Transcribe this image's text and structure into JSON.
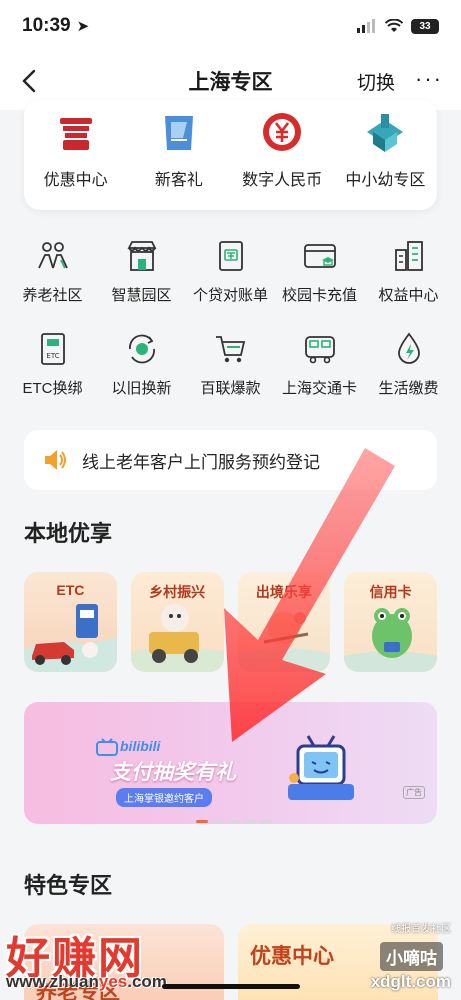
{
  "status": {
    "time": "10:39",
    "battery": "33"
  },
  "nav": {
    "title": "上海专区",
    "switch_label": "切换",
    "more_label": "···"
  },
  "top_items": [
    {
      "label": "优惠中心",
      "icon": "building-icon"
    },
    {
      "label": "新客礼",
      "icon": "gift-icon"
    },
    {
      "label": "数字人民币",
      "icon": "yuan-icon"
    },
    {
      "label": "中小幼专区",
      "icon": "cube-building-icon"
    }
  ],
  "grid_items": [
    {
      "label": "养老社区",
      "icon": "elderly-icon"
    },
    {
      "label": "智慧园区",
      "icon": "store-icon"
    },
    {
      "label": "个贷对账单",
      "icon": "loan-bill-icon"
    },
    {
      "label": "校园卡充值",
      "icon": "campus-card-icon"
    },
    {
      "label": "权益中心",
      "icon": "buildings-icon"
    },
    {
      "label": "ETC换绑",
      "icon": "etc-icon"
    },
    {
      "label": "以旧换新",
      "icon": "trade-in-icon"
    },
    {
      "label": "百联爆款",
      "icon": "cart-icon"
    },
    {
      "label": "上海交通卡",
      "icon": "bus-icon"
    },
    {
      "label": "生活缴费",
      "icon": "bolt-drop-icon"
    }
  ],
  "notice": {
    "text": "线上老年客户上门服务预约登记"
  },
  "local": {
    "title": "本地优享",
    "cards": [
      {
        "label": "ETC"
      },
      {
        "label": "乡村振兴"
      },
      {
        "label": "出境乐享"
      },
      {
        "label": "信用卡"
      }
    ]
  },
  "banner": {
    "brand": "bilibili",
    "title": "支付抽奖有礼",
    "subtitle": "上海掌银邀约客户",
    "ad_tag": "广告"
  },
  "featured": {
    "title": "特色专区",
    "cards": [
      {
        "label": "养老专区"
      },
      {
        "label": "优惠中心"
      }
    ]
  },
  "watermark": {
    "big": "好赚网",
    "url_prefix": "www.zhuan",
    "url_highlight": "yes",
    "url_suffix": ".com",
    "right_top": "线报首发社区",
    "right_mid": "小嘀咕",
    "right_bottom": "xdglt.com"
  },
  "colors": {
    "accent": "#e23a2e",
    "brand_red": "#c0431c",
    "green": "#2db37a"
  }
}
